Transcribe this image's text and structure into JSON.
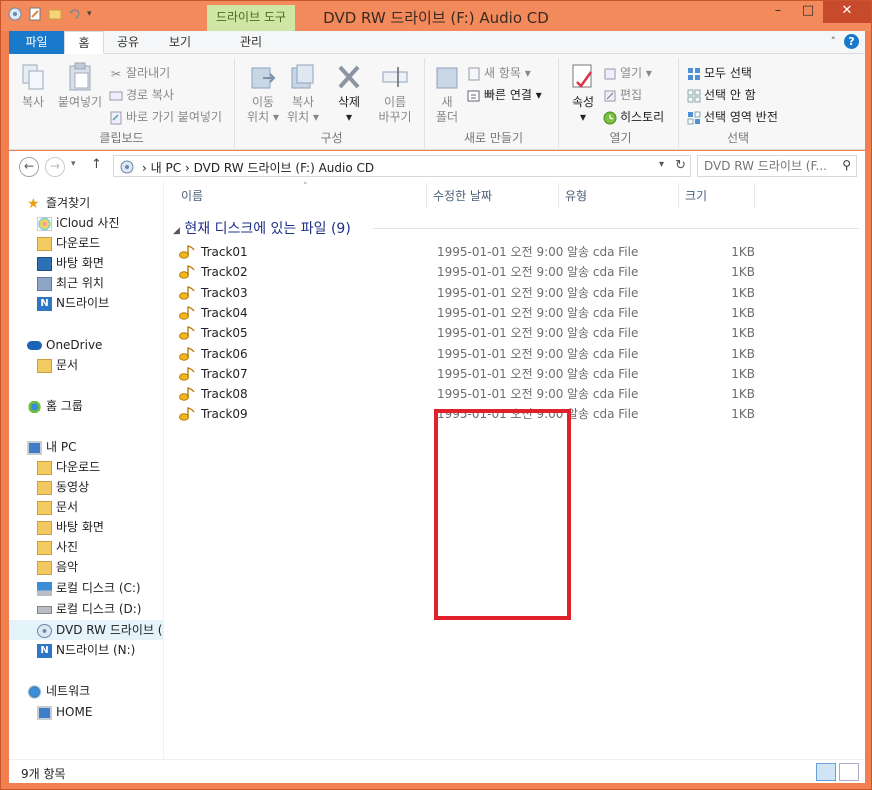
{
  "window": {
    "title": "DVD RW 드라이브 (F:) Audio CD",
    "context_tab_header": "드라이브 도구",
    "controls": [
      "–",
      "□",
      "✕"
    ]
  },
  "ribbon_tabs": [
    "파일",
    "홈",
    "공유",
    "보기",
    "관리"
  ],
  "ribbon": {
    "clipboard": {
      "label": "클립보드",
      "copy": "복사",
      "paste": "붙여넣기",
      "cut": "잘라내기",
      "copy_path": "경로 복사",
      "paste_shortcut": "바로 가기 붙여넣기"
    },
    "organize": {
      "label": "구성",
      "move_to_1": "이동",
      "move_to_2": "위치",
      "copy_to_1": "복사",
      "copy_to_2": "위치",
      "delete": "삭제",
      "rename_1": "이름",
      "rename_2": "바꾸기"
    },
    "new": {
      "label": "새로 만들기",
      "new_folder_1": "새",
      "new_folder_2": "폴더",
      "new_item": "새 항목",
      "easy_access": "빠른 연결"
    },
    "open": {
      "label": "열기",
      "properties": "속성",
      "open": "열기",
      "edit": "편집",
      "history": "히스토리"
    },
    "select": {
      "label": "선택",
      "select_all": "모두 선택",
      "select_none": "선택 안 함",
      "invert": "선택 영역 반전"
    }
  },
  "address": {
    "path": [
      "내 PC",
      "DVD RW 드라이브 (F:) Audio CD"
    ],
    "search_placeholder": "DVD RW 드라이브 (F..."
  },
  "nav_pane": {
    "favorites": {
      "label": "즐겨찾기",
      "items": [
        "iCloud 사진",
        "다운로드",
        "바탕 화면",
        "최근 위치",
        "N드라이브"
      ]
    },
    "onedrive": {
      "label": "OneDrive",
      "items": [
        "문서"
      ]
    },
    "homegroup": {
      "label": "홈 그룹"
    },
    "thispc": {
      "label": "내 PC",
      "items": [
        "다운로드",
        "동영상",
        "문서",
        "바탕 화면",
        "사진",
        "음악",
        "로컬 디스크 (C:)",
        "로컬 디스크 (D:)",
        "DVD RW 드라이브 (",
        "N드라이브 (N:)"
      ]
    },
    "network": {
      "label": "네트워크",
      "items": [
        "HOME"
      ]
    }
  },
  "columns": [
    "이름",
    "수정한 날짜",
    "유형",
    "크기"
  ],
  "group_header": "현재 디스크에 있는 파일 (9)",
  "files": [
    {
      "name": "Track01",
      "date": "1995-01-01 오전 9:00",
      "type": "알송 cda File",
      "size": "1KB"
    },
    {
      "name": "Track02",
      "date": "1995-01-01 오전 9:00",
      "type": "알송 cda File",
      "size": "1KB"
    },
    {
      "name": "Track03",
      "date": "1995-01-01 오전 9:00",
      "type": "알송 cda File",
      "size": "1KB"
    },
    {
      "name": "Track04",
      "date": "1995-01-01 오전 9:00",
      "type": "알송 cda File",
      "size": "1KB"
    },
    {
      "name": "Track05",
      "date": "1995-01-01 오전 9:00",
      "type": "알송 cda File",
      "size": "1KB"
    },
    {
      "name": "Track06",
      "date": "1995-01-01 오전 9:00",
      "type": "알송 cda File",
      "size": "1KB"
    },
    {
      "name": "Track07",
      "date": "1995-01-01 오전 9:00",
      "type": "알송 cda File",
      "size": "1KB"
    },
    {
      "name": "Track08",
      "date": "1995-01-01 오전 9:00",
      "type": "알송 cda File",
      "size": "1KB"
    },
    {
      "name": "Track09",
      "date": "1995-01-01 오전 9:00",
      "type": "알송 cda File",
      "size": "1KB"
    }
  ],
  "status": {
    "count": "9개 항목"
  },
  "colors": {
    "title_bar": "#f38a5c",
    "file_tab": "#1979ca",
    "context_tab": "#cfe6a5",
    "annotation": "#e0202a"
  }
}
